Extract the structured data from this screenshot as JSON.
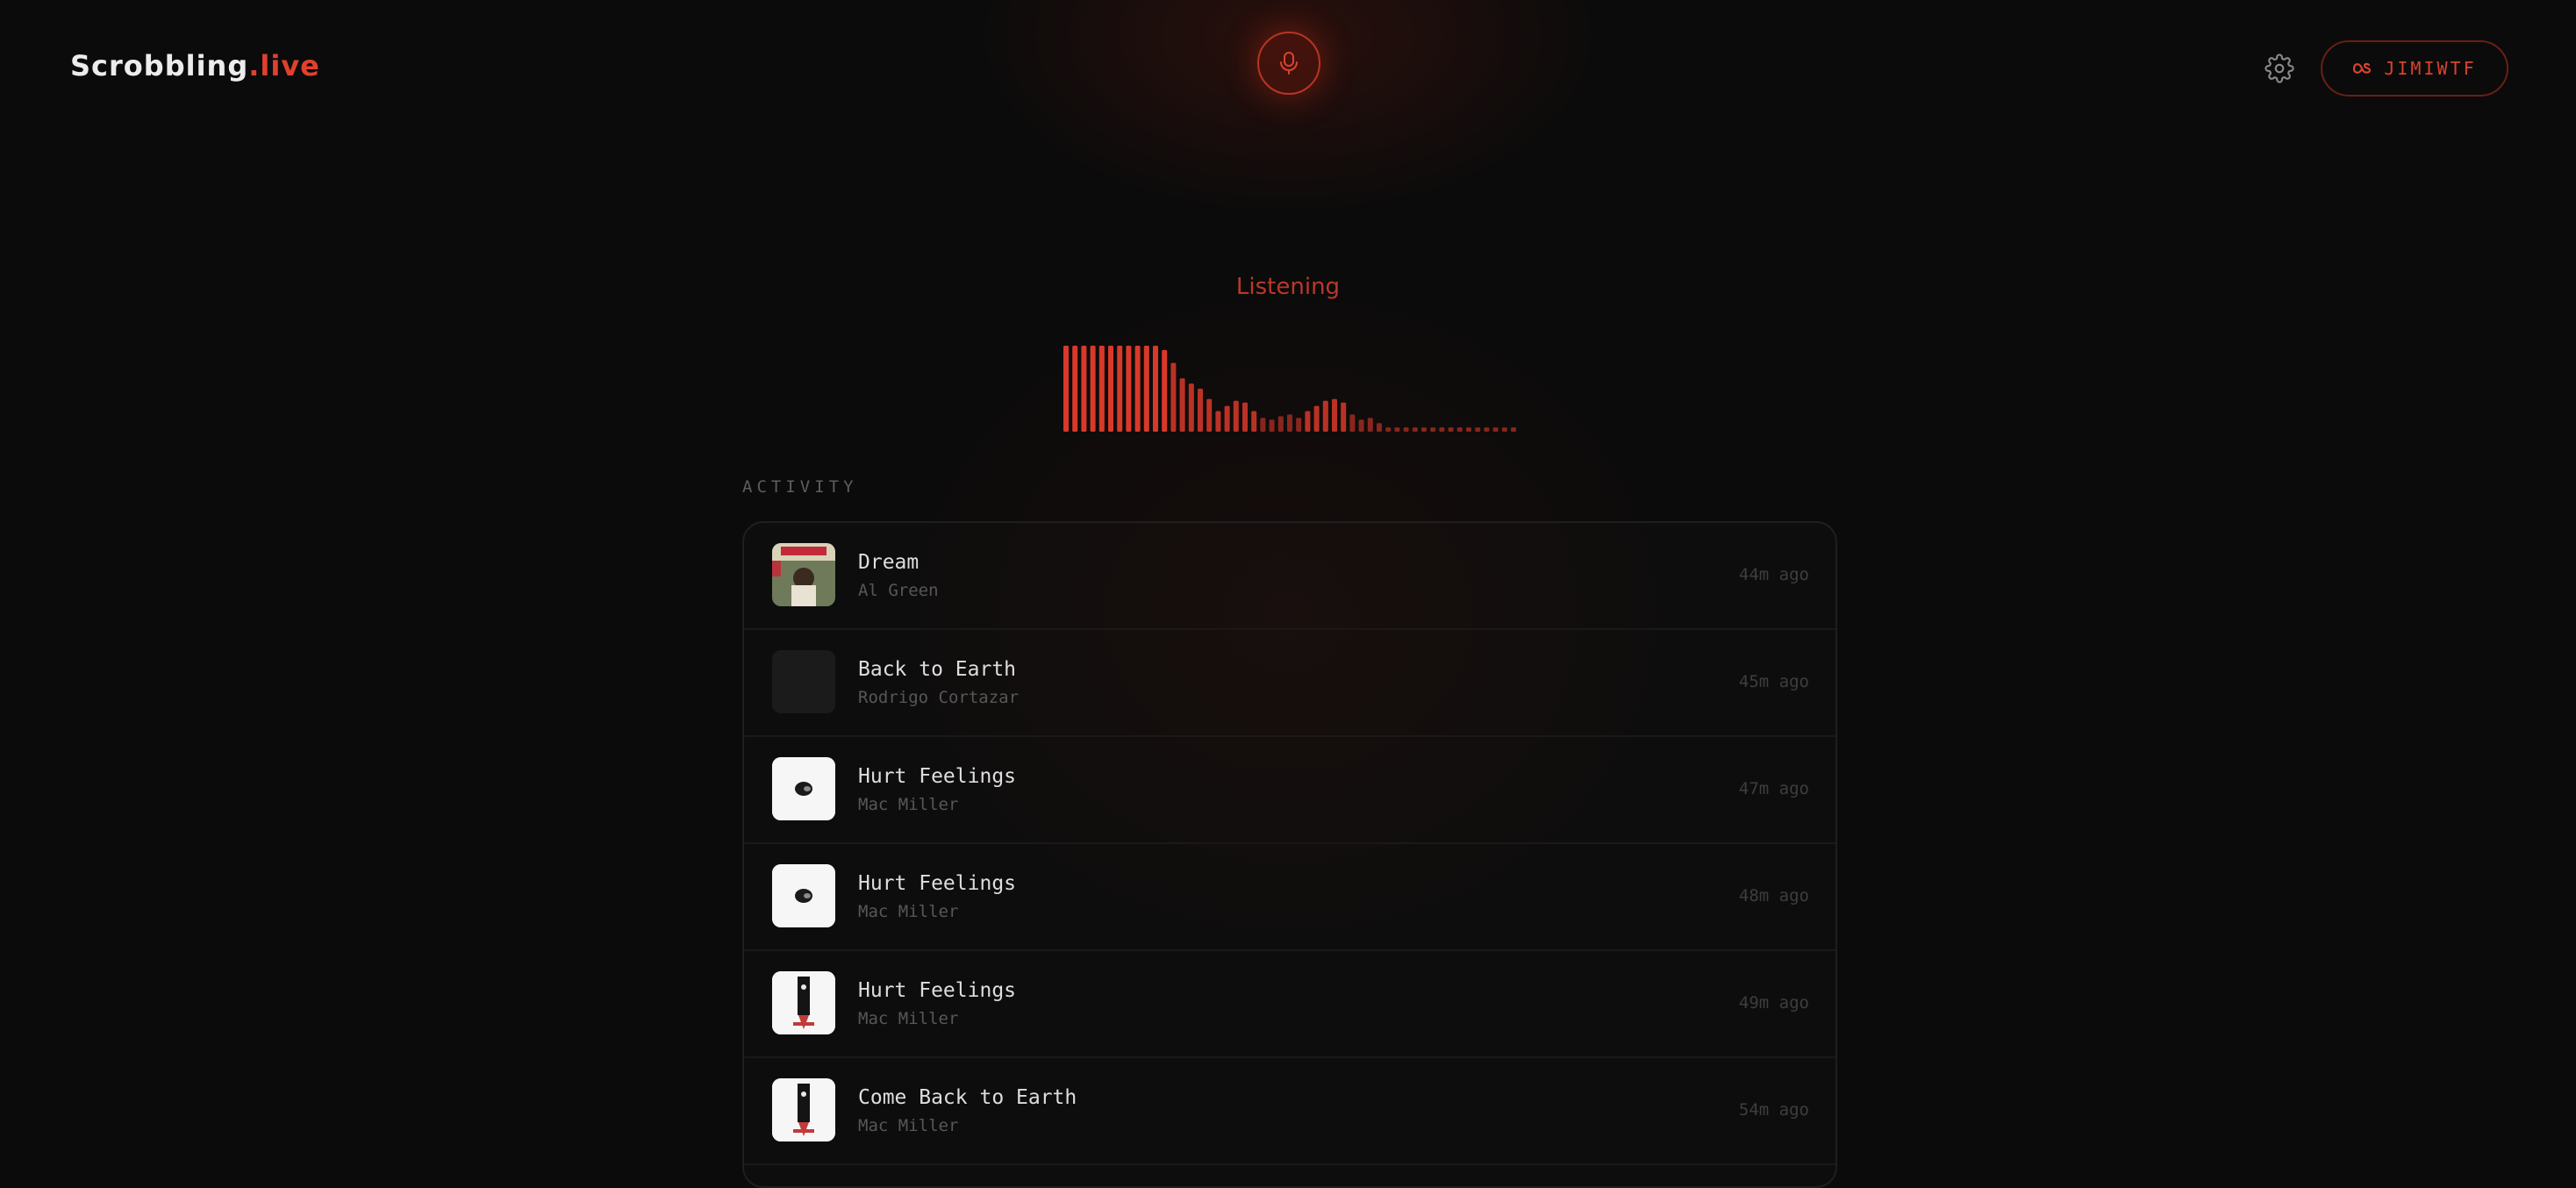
{
  "brand": {
    "name": "Scrobbling",
    "suffix": ".live"
  },
  "header": {
    "mic_icon": "microphone-icon",
    "settings_icon": "gear-icon",
    "user_icon": "lastfm-icon",
    "username": "JIMIWTF"
  },
  "status": {
    "text": "Listening"
  },
  "visualizer": {
    "accent": "#d8392a",
    "levels": [
      1.0,
      1.0,
      1.0,
      1.0,
      1.0,
      1.0,
      1.0,
      1.0,
      1.0,
      1.0,
      1.0,
      0.95,
      0.8,
      0.62,
      0.56,
      0.5,
      0.38,
      0.24,
      0.3,
      0.36,
      0.34,
      0.24,
      0.16,
      0.14,
      0.18,
      0.2,
      0.16,
      0.24,
      0.3,
      0.36,
      0.38,
      0.34,
      0.2,
      0.14,
      0.16,
      0.1,
      0.05,
      0.05,
      0.05,
      0.05,
      0.05,
      0.05,
      0.05,
      0.05,
      0.05,
      0.05,
      0.05,
      0.05,
      0.05,
      0.05,
      0.05
    ]
  },
  "activity": {
    "label": "ACTIVITY",
    "items": [
      {
        "title": "Dream",
        "artist": "Al Green",
        "time": "44m ago",
        "art": "al-green"
      },
      {
        "title": "Back to Earth",
        "artist": "Rodrigo Cortazar",
        "time": "45m ago",
        "art": "empty"
      },
      {
        "title": "Hurt Feelings",
        "artist": "Mac Miller",
        "time": "47m ago",
        "art": "swimming"
      },
      {
        "title": "Hurt Feelings",
        "artist": "Mac Miller",
        "time": "48m ago",
        "art": "swimming"
      },
      {
        "title": "Hurt Feelings",
        "artist": "Mac Miller",
        "time": "49m ago",
        "art": "circles"
      },
      {
        "title": "Come Back to Earth",
        "artist": "Mac Miller",
        "time": "54m ago",
        "art": "circles"
      }
    ]
  },
  "colors": {
    "accent": "#e0402e",
    "background": "#0b0b0b",
    "border": "#1f1f1f"
  }
}
